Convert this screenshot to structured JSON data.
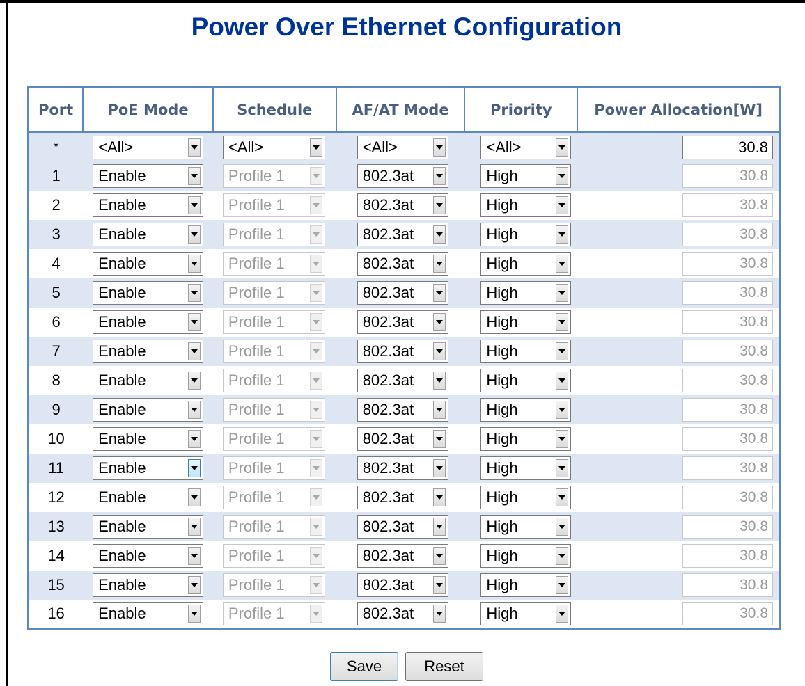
{
  "title": "Power Over Ethernet Configuration",
  "columns": {
    "port": "Port",
    "poe_mode": "PoE Mode",
    "schedule": "Schedule",
    "afat_mode": "AF/AT Mode",
    "priority": "Priority",
    "power_allocation": "Power Allocation[W]"
  },
  "all_row": {
    "port": "*",
    "poe_mode": "<All>",
    "schedule": "<All>",
    "afat_mode": "<All>",
    "priority": "<All>",
    "power_allocation": "30.8"
  },
  "ports": [
    {
      "port": "1",
      "poe_mode": "Enable",
      "schedule": "Profile 1",
      "afat_mode": "802.3at",
      "priority": "High",
      "power_allocation": "30.8"
    },
    {
      "port": "2",
      "poe_mode": "Enable",
      "schedule": "Profile 1",
      "afat_mode": "802.3at",
      "priority": "High",
      "power_allocation": "30.8"
    },
    {
      "port": "3",
      "poe_mode": "Enable",
      "schedule": "Profile 1",
      "afat_mode": "802.3at",
      "priority": "High",
      "power_allocation": "30.8"
    },
    {
      "port": "4",
      "poe_mode": "Enable",
      "schedule": "Profile 1",
      "afat_mode": "802.3at",
      "priority": "High",
      "power_allocation": "30.8"
    },
    {
      "port": "5",
      "poe_mode": "Enable",
      "schedule": "Profile 1",
      "afat_mode": "802.3at",
      "priority": "High",
      "power_allocation": "30.8"
    },
    {
      "port": "6",
      "poe_mode": "Enable",
      "schedule": "Profile 1",
      "afat_mode": "802.3at",
      "priority": "High",
      "power_allocation": "30.8"
    },
    {
      "port": "7",
      "poe_mode": "Enable",
      "schedule": "Profile 1",
      "afat_mode": "802.3at",
      "priority": "High",
      "power_allocation": "30.8"
    },
    {
      "port": "8",
      "poe_mode": "Enable",
      "schedule": "Profile 1",
      "afat_mode": "802.3at",
      "priority": "High",
      "power_allocation": "30.8"
    },
    {
      "port": "9",
      "poe_mode": "Enable",
      "schedule": "Profile 1",
      "afat_mode": "802.3at",
      "priority": "High",
      "power_allocation": "30.8"
    },
    {
      "port": "10",
      "poe_mode": "Enable",
      "schedule": "Profile 1",
      "afat_mode": "802.3at",
      "priority": "High",
      "power_allocation": "30.8"
    },
    {
      "port": "11",
      "poe_mode": "Enable",
      "schedule": "Profile 1",
      "afat_mode": "802.3at",
      "priority": "High",
      "power_allocation": "30.8"
    },
    {
      "port": "12",
      "poe_mode": "Enable",
      "schedule": "Profile 1",
      "afat_mode": "802.3at",
      "priority": "High",
      "power_allocation": "30.8"
    },
    {
      "port": "13",
      "poe_mode": "Enable",
      "schedule": "Profile 1",
      "afat_mode": "802.3at",
      "priority": "High",
      "power_allocation": "30.8"
    },
    {
      "port": "14",
      "poe_mode": "Enable",
      "schedule": "Profile 1",
      "afat_mode": "802.3at",
      "priority": "High",
      "power_allocation": "30.8"
    },
    {
      "port": "15",
      "poe_mode": "Enable",
      "schedule": "Profile 1",
      "afat_mode": "802.3at",
      "priority": "High",
      "power_allocation": "30.8"
    },
    {
      "port": "16",
      "poe_mode": "Enable",
      "schedule": "Profile 1",
      "afat_mode": "802.3at",
      "priority": "High",
      "power_allocation": "30.8"
    }
  ],
  "buttons": {
    "save": "Save",
    "reset": "Reset"
  },
  "colors": {
    "title": "#003399",
    "header_text": "#4a5f80",
    "table_border": "#5b87c3",
    "row_shade": "#dde6f2",
    "disabled_text": "#9b9b9b"
  },
  "icons": {
    "dropdown": "chevron-down-icon"
  }
}
